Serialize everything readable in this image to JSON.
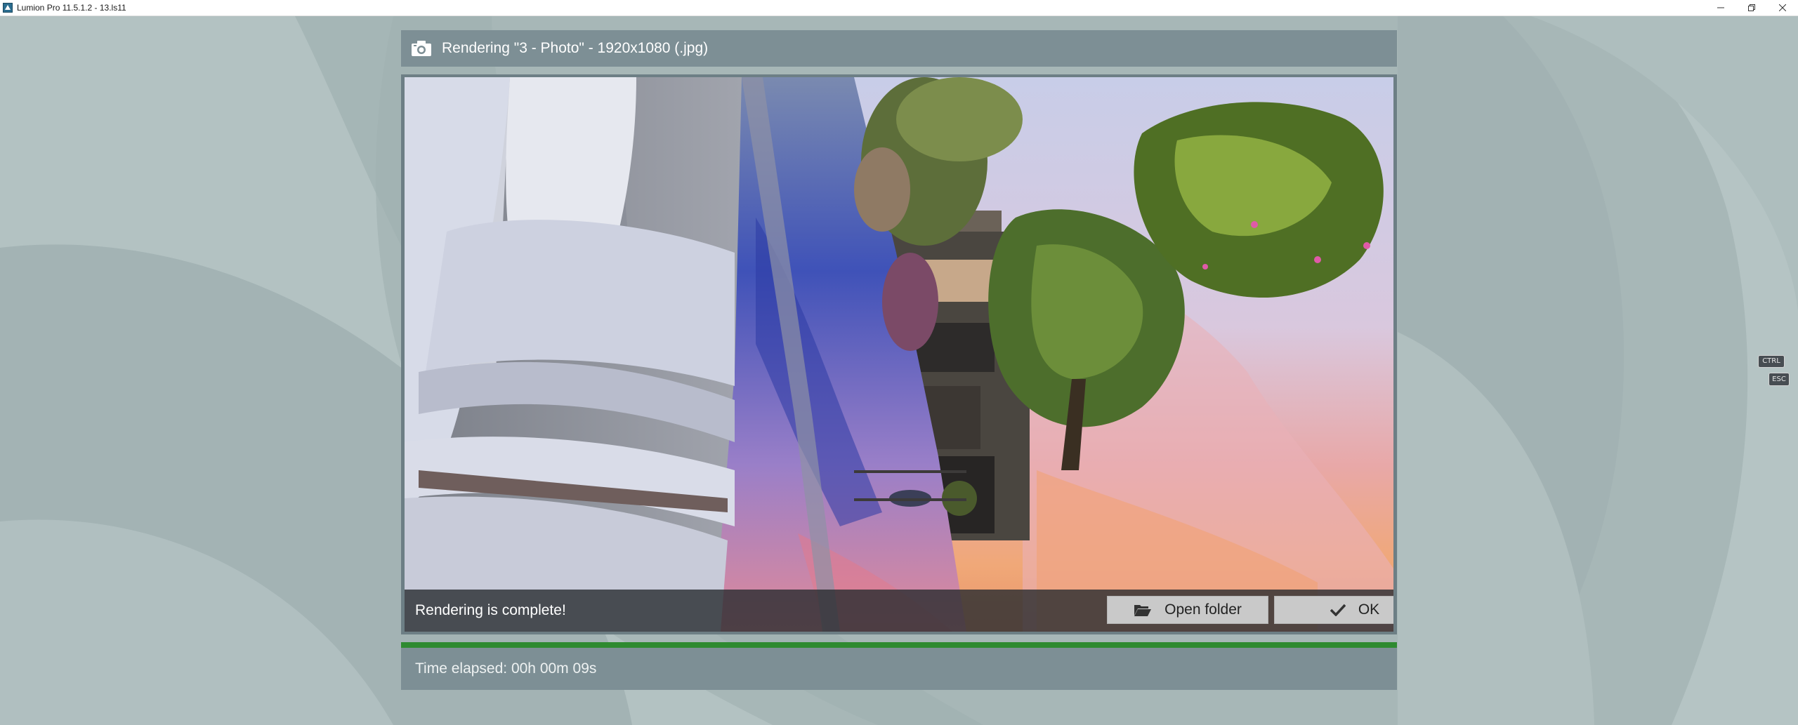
{
  "window": {
    "title": "Lumion Pro 11.5.1.2  - 13.ls11",
    "controls": [
      "minimize-icon",
      "restore-icon",
      "close-icon"
    ]
  },
  "dialog": {
    "title": "Rendering \"3 - Photo\" - 1920x1080 (.jpg)",
    "status_text": "Rendering is complete!",
    "open_folder_label": "Open folder",
    "ok_label": "OK",
    "time_elapsed": "Time elapsed: 00h 00m 09s",
    "progress": 1.0
  },
  "key_hints": {
    "ctrl": "CTRL",
    "esc": "ESC"
  },
  "icons": {
    "app": "lumion-app-icon",
    "camera": "camera-icon",
    "folder": "folder-open-icon",
    "check": "checkmark-icon"
  },
  "colors": {
    "background": "#a9b8b8",
    "header": "#7d8f95",
    "progress": "#2e8a30"
  }
}
